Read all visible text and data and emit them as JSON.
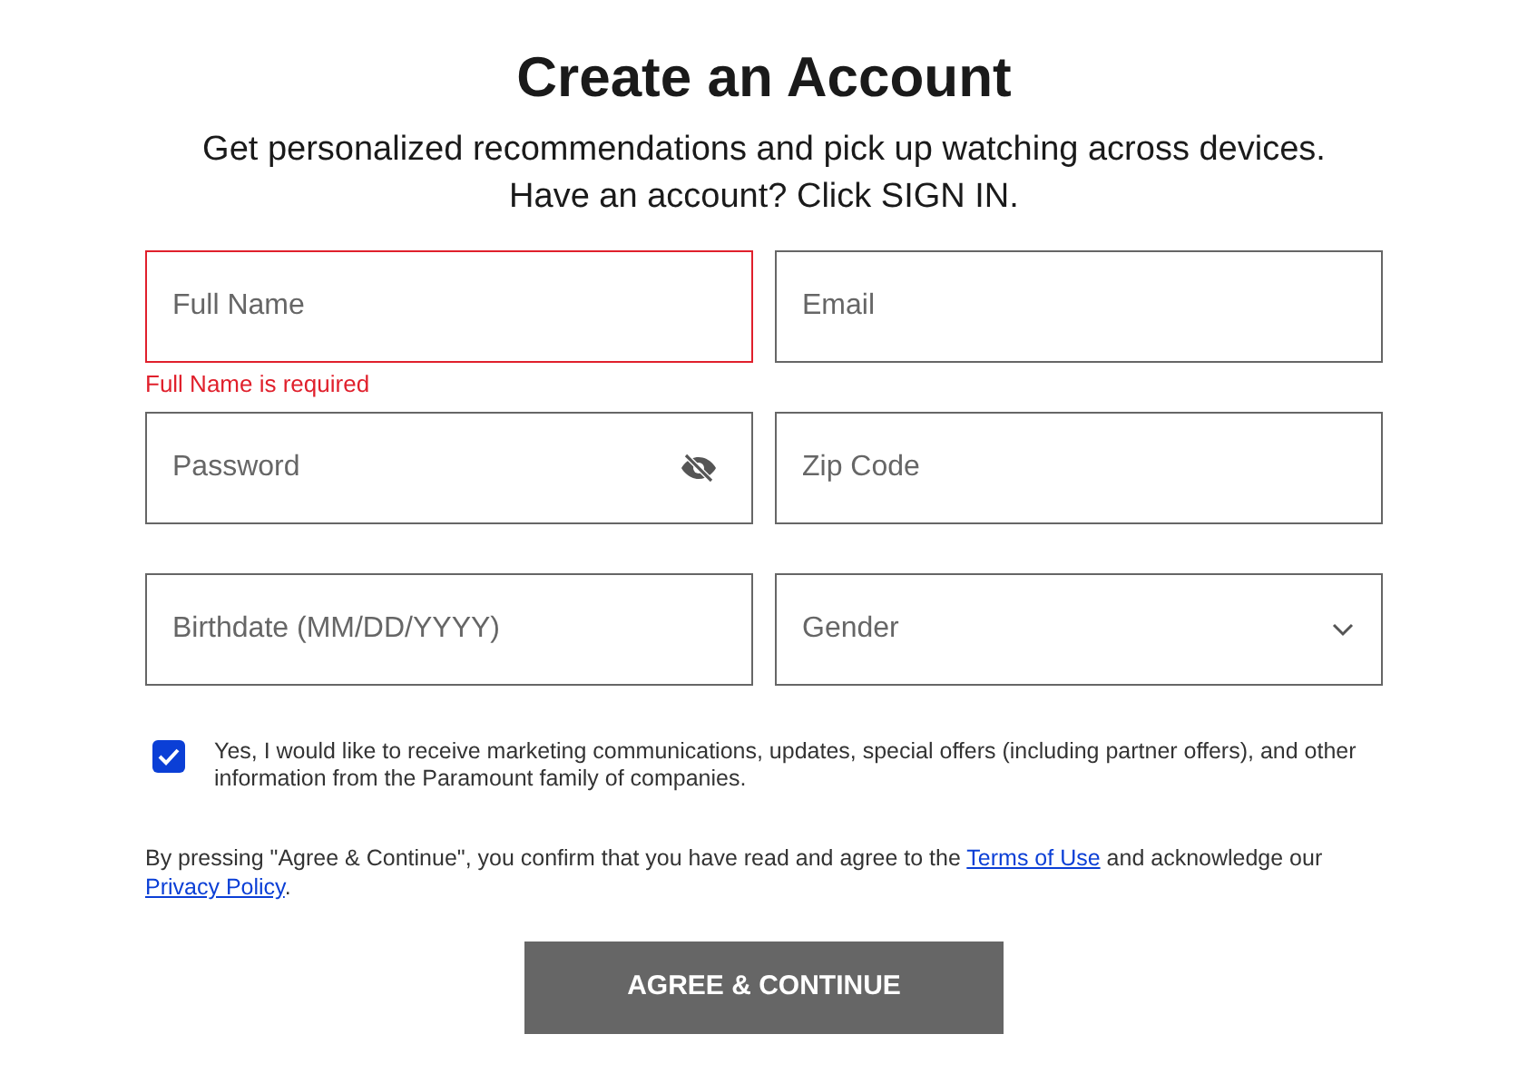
{
  "title": "Create an Account",
  "subtitle": "Get personalized recommendations and pick up watching across devices. Have an account? Click SIGN IN.",
  "field_rows": [
    [
      {
        "kind": "text",
        "placeholder": "Full Name",
        "error": "Full Name is required"
      },
      {
        "kind": "text",
        "placeholder": "Email"
      }
    ],
    [
      {
        "kind": "password",
        "placeholder": "Password"
      },
      {
        "kind": "text",
        "placeholder": "Zip Code"
      }
    ],
    [
      {
        "kind": "text",
        "placeholder": "Birthdate (MM/DD/YYYY)"
      },
      {
        "kind": "select",
        "placeholder": "Gender"
      }
    ]
  ],
  "marketing_opt_in": {
    "checked": true,
    "label": "Yes, I would like to receive marketing communications, updates, special offers (including partner offers), and other information from the Paramount family of companies."
  },
  "legal": [
    {
      "kind": "text",
      "text": "By pressing \"Agree & Continue\", you confirm that you have read and agree to the "
    },
    {
      "kind": "link",
      "text": "Terms of Use"
    },
    {
      "kind": "text",
      "text": " and acknowledge our "
    },
    {
      "kind": "link",
      "text": "Privacy Policy"
    },
    {
      "kind": "text",
      "text": "."
    }
  ],
  "submit_button": "AGREE & CONTINUE"
}
